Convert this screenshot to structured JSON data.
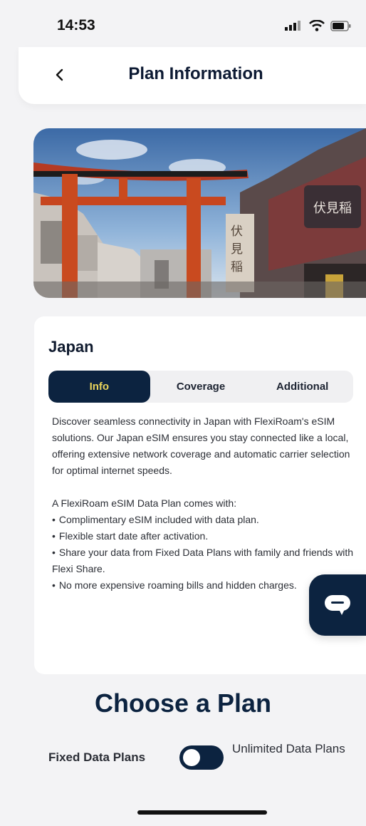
{
  "status_bar": {
    "time": "14:53",
    "icons": [
      "cellular-signal-icon",
      "wifi-icon",
      "battery-icon"
    ]
  },
  "header": {
    "title": "Plan Information",
    "back_icon": "chevron-left-icon"
  },
  "hero_image": {
    "subject": "torii gate street scene"
  },
  "plan_card": {
    "country": "Japan",
    "tabs": [
      {
        "label": "Info",
        "active": true
      },
      {
        "label": "Coverage",
        "active": false
      },
      {
        "label": "Additional",
        "active": false
      }
    ],
    "description": "Discover seamless connectivity in Japan with FlexiRoam's eSIM solutions. Our Japan eSIM ensures you stay connected like a local, offering extensive network coverage and automatic carrier selection for optimal internet speeds.",
    "features_intro": "A FlexiRoam eSIM Data Plan comes with:",
    "features": [
      "Complimentary eSIM included with data plan.",
      "Flexible start date after activation.",
      "Share your data from Fixed Data Plans with family and friends with Flexi Share.",
      "No more expensive roaming bills and hidden charges."
    ]
  },
  "chat_button": {
    "icon": "chat-bubble-icon"
  },
  "choose_plan": {
    "title": "Choose a Plan",
    "fixed_label": "Fixed Data Plans",
    "unlimited_label": "Unlimited Data Plans",
    "toggle_selected": "Fixed Data Plans"
  },
  "colors": {
    "navy": "#0c2340",
    "active_tab_text": "#e9d35a",
    "background": "#f3f3f5"
  }
}
